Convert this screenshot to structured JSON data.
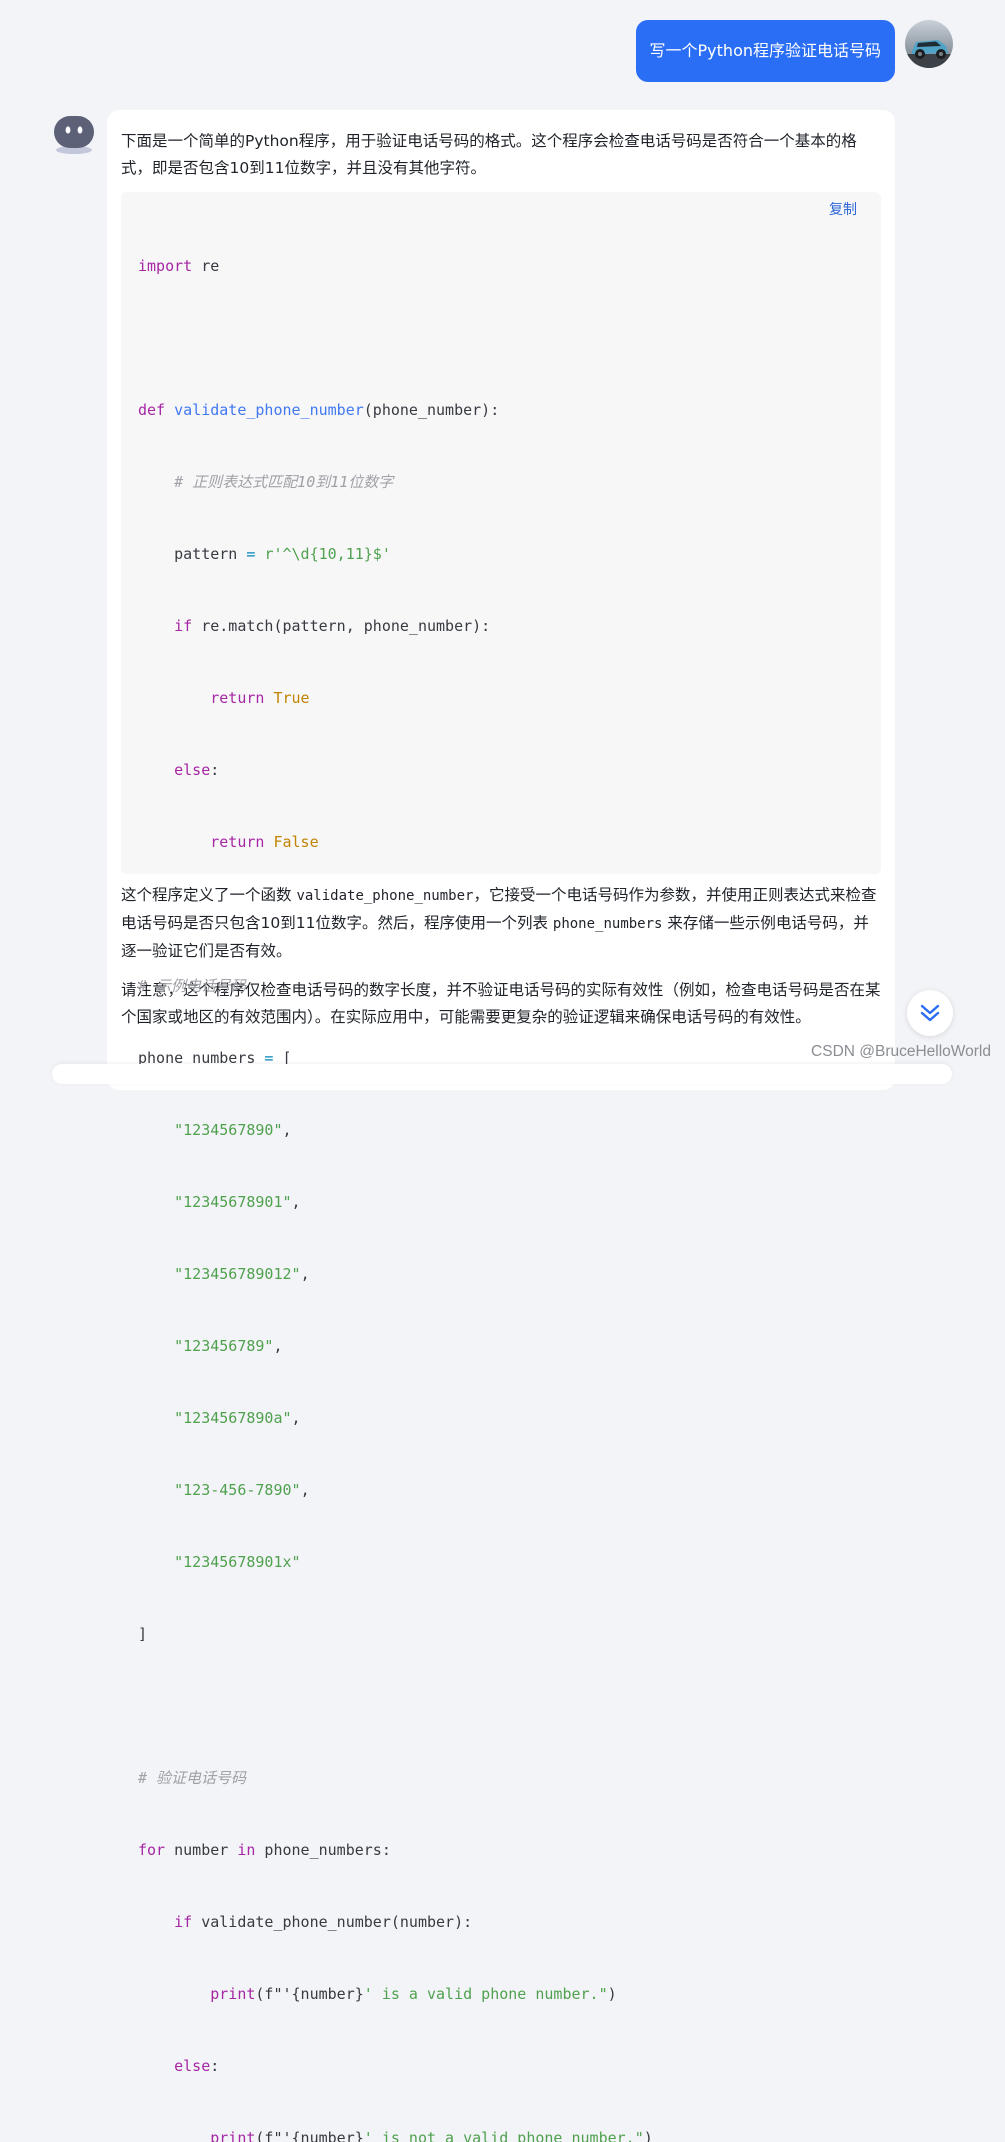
{
  "user_message": {
    "text": "写一个Python程序验证电话号码",
    "avatar_icon": "car-avatar-icon"
  },
  "bot": {
    "avatar_icon": "robot-avatar-icon",
    "intro": "下面是一个简单的Python程序，用于验证电话号码的格式。这个程序会检查电话号码是否符合一个基本的格式，即是否包含10到11位数字，并且没有其他字符。",
    "copy_label": "复制",
    "code_lang": "python",
    "explanation": {
      "part1": "这个程序定义了一个函数 ",
      "code1": "validate_phone_number",
      "part2": "，它接受一个电话号码作为参数，并使用正则表达式来检查电话号码是否只包含10到11位数字。然后，程序使用一个列表 ",
      "code2": "phone_numbers",
      "part3": " 来存储一些示例电话号码，并逐一验证它们是否有效。"
    },
    "note": "请注意，这个程序仅检查电话号码的数字长度，并不验证电话号码的实际有效性（例如，检查电话号码是否在某个国家或地区的有效范围内）。在实际应用中，可能需要更复杂的验证逻辑来确保电话号码的有效性。"
  },
  "code": {
    "import_kw": "import",
    "import_mod": " re",
    "def_kw": "def",
    "func_name": "validate_phone_number",
    "param": "(phone_number):",
    "comment1": "# 正则表达式匹配10到11位数字",
    "pattern_var": "pattern",
    "assign": " = ",
    "pattern_str": "r'^\\d{10,11}$'",
    "if_kw": "if",
    "match_call": " re.match(pattern, phone_number):",
    "return_kw": "return",
    "true_val": "True",
    "else_kw": "else",
    "colon": ":",
    "false_val": "False",
    "comment2": "# 示例电话号码",
    "list_var": "phone_numbers",
    "list_open": "[",
    "numbers": [
      "\"1234567890\"",
      "\"12345678901\"",
      "\"123456789012\"",
      "\"123456789\"",
      "\"1234567890a\"",
      "\"123-456-7890\"",
      "\"12345678901x\""
    ],
    "comma": ",",
    "list_close": "]",
    "comment3": "# 验证电话号码",
    "for_kw": "for",
    "loop_var": " number ",
    "in_kw": "in",
    "loop_iter": " phone_numbers:",
    "if_call": " validate_phone_number(number):",
    "print_fn": "print",
    "print_open": "(f\"'",
    "fvar": "{number}",
    "valid_msg": "' is a valid phone number.\"",
    "invalid_msg": "' is not a valid phone number.\"",
    "print_close": ")"
  },
  "scroll_button": {
    "icon": "double-chevron-down-icon"
  },
  "watermark": "CSDN @BruceHelloWorld",
  "colors": {
    "user_bubble": "#2b6ef6",
    "link": "#2f67d6",
    "page_bg": "#f3f4f7"
  }
}
